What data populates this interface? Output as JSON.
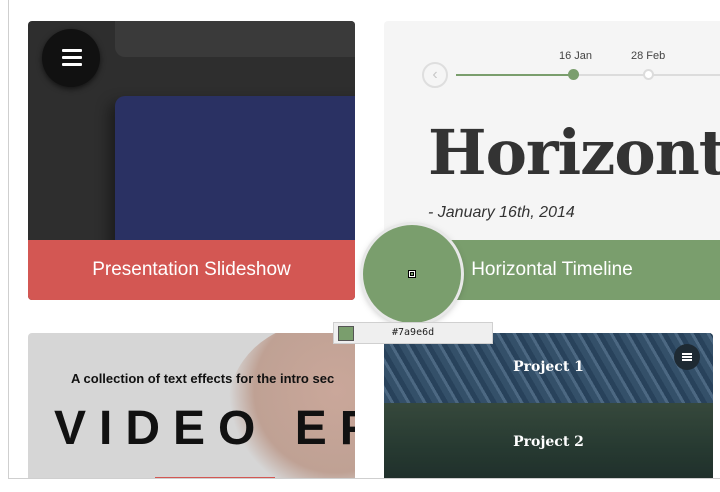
{
  "cards": {
    "slideshow": {
      "label": "Presentation Slideshow",
      "menu_icon": "hamburger-menu-icon",
      "label_bg": "#d35753"
    },
    "timeline": {
      "label": "Horizontal Timeline",
      "dates": [
        "16 Jan",
        "28 Feb"
      ],
      "heading": "Horizonta",
      "subheading": "- January 16th, 2014",
      "accent": "#7a9e6d",
      "prev_icon": "chevron-left-icon"
    },
    "video": {
      "subtitle": "A collection of text effects for the intro sec",
      "title": "VIDEO EF"
    },
    "projects": {
      "items": [
        "Project 1",
        "Project 2"
      ],
      "menu_icon": "hamburger-menu-icon"
    }
  },
  "color_picker": {
    "hex": "#7a9e6d",
    "color": "#7a9e6d"
  }
}
